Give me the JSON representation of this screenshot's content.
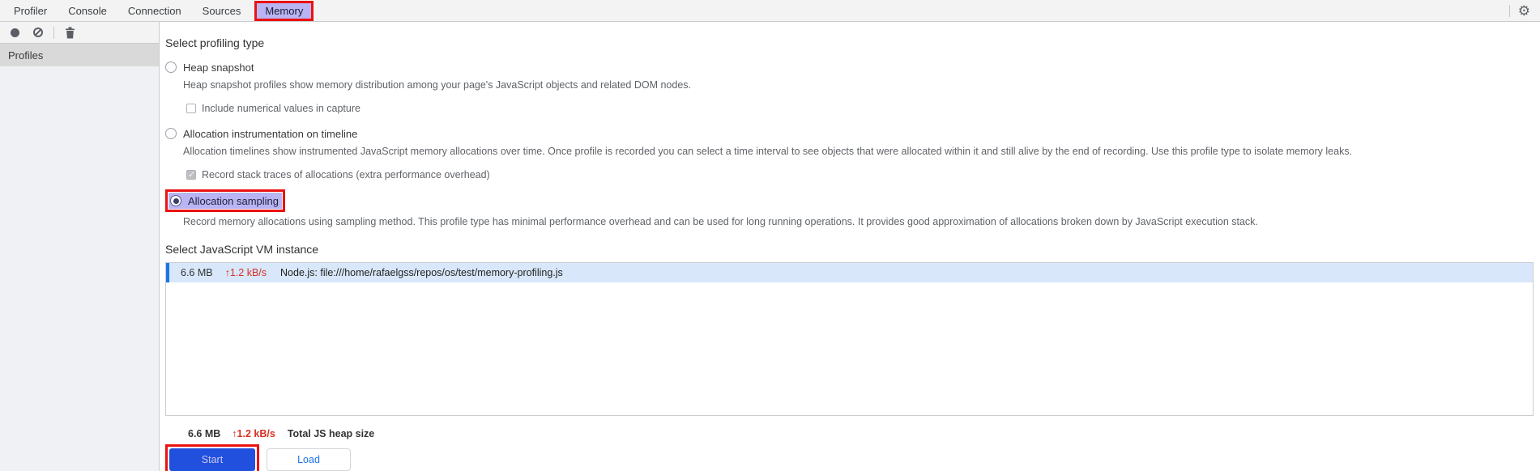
{
  "tabs": {
    "items": [
      {
        "label": "Profiler",
        "active": false
      },
      {
        "label": "Console",
        "active": false
      },
      {
        "label": "Connection",
        "active": false
      },
      {
        "label": "Sources",
        "active": false
      },
      {
        "label": "Memory",
        "active": true,
        "annotated": true
      }
    ]
  },
  "toolbar": {
    "icons": [
      {
        "name": "record-icon"
      },
      {
        "name": "clear-icon"
      },
      {
        "name": "trash-icon"
      }
    ],
    "settings_icon": "gear-icon",
    "gear_glyph": "⚙"
  },
  "sidebar": {
    "profiles_label": "Profiles"
  },
  "main": {
    "profiling_type": {
      "heading": "Select profiling type",
      "options": [
        {
          "label": "Heap snapshot",
          "selected": false,
          "description": "Heap snapshot profiles show memory distribution among your page's JavaScript objects and related DOM nodes.",
          "checkbox": {
            "label": "Include numerical values in capture",
            "checked": false
          }
        },
        {
          "label": "Allocation instrumentation on timeline",
          "selected": false,
          "description": "Allocation timelines show instrumented JavaScript memory allocations over time. Once profile is recorded you can select a time interval to see objects that were allocated within it and still alive by the end of recording. Use this profile type to isolate memory leaks.",
          "checkbox": {
            "label": "Record stack traces of allocations (extra performance overhead)",
            "checked": true
          }
        },
        {
          "label": "Allocation sampling",
          "selected": true,
          "annotated": true,
          "description": "Record memory allocations using sampling method. This profile type has minimal performance overhead and can be used for long running operations. It provides good approximation of allocations broken down by JavaScript execution stack."
        }
      ]
    },
    "vm_instance": {
      "heading": "Select JavaScript VM instance",
      "rows": [
        {
          "size": "6.6 MB",
          "rate": "↑1.2 kB/s",
          "name": "Node.js: file:///home/rafaelgss/repos/os/test/memory-profiling.js",
          "selected": true
        }
      ],
      "total": {
        "size": "6.6 MB",
        "rate": "↑1.2 kB/s",
        "label": "Total JS heap size"
      }
    },
    "actions": {
      "start_label": "Start",
      "load_label": "Load"
    }
  },
  "colors": {
    "accent-red": "#ec1111",
    "tab-active-bg": "#b9b4f3",
    "row-selected-bg": "#d8e7fa",
    "row-accent": "#1a73e8",
    "start-bg": "#2150df",
    "start-text": "#c9c7f3",
    "load-text": "#1a73e8",
    "rate-red": "#d93025"
  }
}
